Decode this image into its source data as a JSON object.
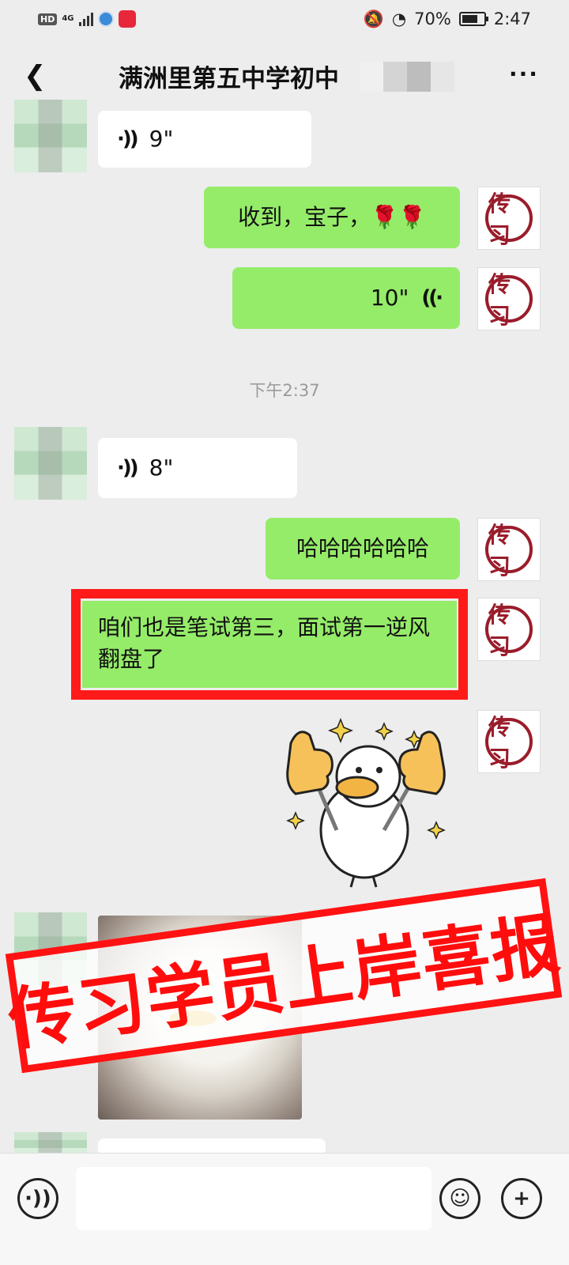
{
  "status_bar": {
    "hd": "HD",
    "network": "4G",
    "battery_percent": "70%",
    "time": "2:47"
  },
  "header": {
    "title": "满洲里第五中学初中"
  },
  "messages": [
    {
      "side": "left",
      "type": "voice",
      "duration": "9\""
    },
    {
      "side": "right",
      "type": "text",
      "text": "收到，宝子，🌹🌹"
    },
    {
      "side": "right",
      "type": "voice",
      "duration": "10\""
    },
    {
      "type": "timestamp",
      "text": "下午2:37"
    },
    {
      "side": "left",
      "type": "voice",
      "duration": "8\""
    },
    {
      "side": "right",
      "type": "text",
      "text": "哈哈哈哈哈哈"
    },
    {
      "side": "right",
      "type": "text",
      "text": "咱们也是笔试第三，面试第一逆风翻盘了",
      "highlighted": true
    },
    {
      "side": "right",
      "type": "sticker",
      "icon": "thumbs-up-duck-sticker"
    },
    {
      "side": "left",
      "type": "image",
      "icon": "photo"
    }
  ],
  "avatar_logo_text": "传习",
  "stamp": {
    "text": "传习学员上岸喜报",
    "color": "#ff1212"
  },
  "colors": {
    "bubble_self": "#95ec69",
    "bubble_other": "#ffffff",
    "background": "#ededed"
  },
  "icons": {
    "back": "chevron-left-icon",
    "more": "more-dots-icon",
    "voice_toggle": "voice-icon",
    "emoji": "emoji-icon",
    "add": "plus-icon"
  }
}
